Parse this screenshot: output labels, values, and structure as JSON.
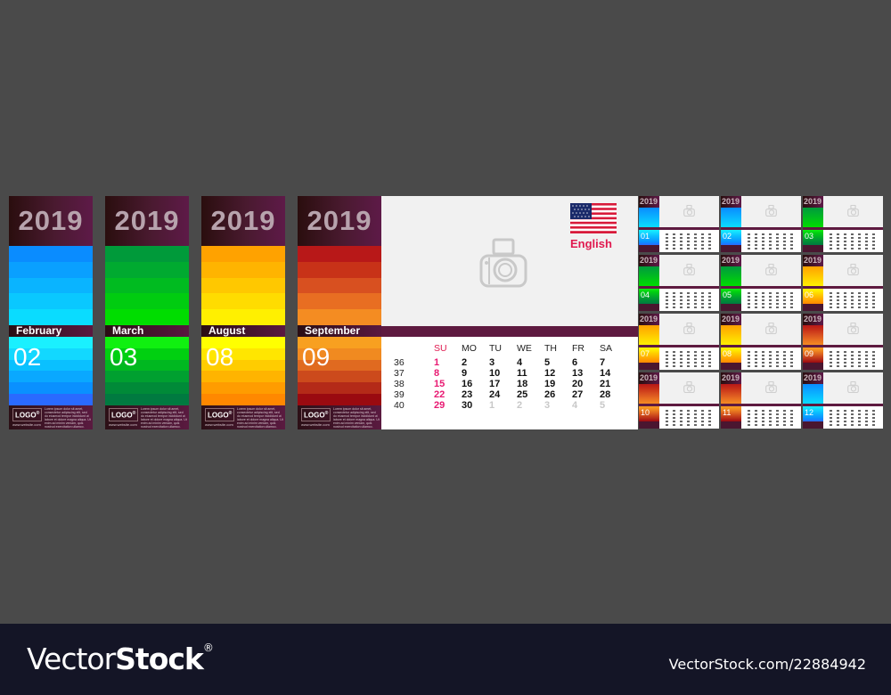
{
  "strips": [
    {
      "year": "2019",
      "month": "February",
      "number": "02",
      "theme": "blue"
    },
    {
      "year": "2019",
      "month": "March",
      "number": "03",
      "theme": "green"
    },
    {
      "year": "2019",
      "month": "August",
      "number": "08",
      "theme": "yellow"
    },
    {
      "year": "2019",
      "month": "September",
      "number": "09",
      "theme": "red"
    }
  ],
  "logo": {
    "text": "LOGO",
    "mark": "®",
    "website": "www.website.com",
    "lorem": "Lorem ipsum dolor sit amet, consectetur adipiscing elit, sed do eiusmod tempor incididunt ut labore et dolore magna aliqua. Ut enim ad minim veniam, quis nostrud exercitation ullamco."
  },
  "feature": {
    "language": "English",
    "flag_icon": "us-flag-icon",
    "photo_icon": "camera-icon",
    "weekdays": [
      "SU",
      "MO",
      "TU",
      "WE",
      "TH",
      "FR",
      "SA"
    ],
    "weeks": [
      {
        "wk": "36",
        "days": [
          "1",
          "2",
          "3",
          "4",
          "5",
          "6",
          "7"
        ],
        "muted": []
      },
      {
        "wk": "37",
        "days": [
          "8",
          "9",
          "10",
          "11",
          "12",
          "13",
          "14"
        ],
        "muted": []
      },
      {
        "wk": "38",
        "days": [
          "15",
          "16",
          "17",
          "18",
          "19",
          "20",
          "21"
        ],
        "muted": []
      },
      {
        "wk": "39",
        "days": [
          "22",
          "23",
          "24",
          "25",
          "26",
          "27",
          "28"
        ],
        "muted": []
      },
      {
        "wk": "40",
        "days": [
          "29",
          "30",
          "1",
          "2",
          "3",
          "4",
          "5"
        ],
        "muted": [
          2,
          3,
          4,
          5,
          6
        ]
      }
    ]
  },
  "minis": [
    {
      "year": "2019",
      "num": "01",
      "theme": "blue"
    },
    {
      "year": "2019",
      "num": "02",
      "theme": "blue"
    },
    {
      "year": "2019",
      "num": "03",
      "theme": "green"
    },
    {
      "year": "2019",
      "num": "04",
      "theme": "green"
    },
    {
      "year": "2019",
      "num": "05",
      "theme": "green"
    },
    {
      "year": "2019",
      "num": "06",
      "theme": "yellow"
    },
    {
      "year": "2019",
      "num": "07",
      "theme": "yellow"
    },
    {
      "year": "2019",
      "num": "08",
      "theme": "yellow"
    },
    {
      "year": "2019",
      "num": "09",
      "theme": "red"
    },
    {
      "year": "2019",
      "num": "10",
      "theme": "red"
    },
    {
      "year": "2019",
      "num": "11",
      "theme": "red"
    },
    {
      "year": "2019",
      "num": "12",
      "theme": "blue"
    }
  ],
  "themes": {
    "blue": {
      "top": [
        "#0a8cff",
        "#0aa0ff",
        "#0ab4ff",
        "#0ac8ff",
        "#0adcff"
      ],
      "bottom": [
        "#1af0ff",
        "#12d8ff",
        "#0ac0ff",
        "#0aa8ff",
        "#0a90ff",
        "#2a6aff"
      ]
    },
    "green": {
      "top": [
        "#009a3a",
        "#00aa30",
        "#00bb20",
        "#00cc10",
        "#00dd00"
      ],
      "bottom": [
        "#10f010",
        "#00d010",
        "#00b820",
        "#00a030",
        "#008a38",
        "#007a40"
      ]
    },
    "yellow": {
      "top": [
        "#ffa200",
        "#ffb400",
        "#ffc800",
        "#ffdc00",
        "#fff000"
      ],
      "bottom": [
        "#ffff00",
        "#ffe600",
        "#ffcc00",
        "#ffb400",
        "#ff9c00",
        "#ff8800"
      ]
    },
    "red": {
      "top": [
        "#b81818",
        "#c83218",
        "#d85020",
        "#e86e22",
        "#f48c22"
      ],
      "bottom": [
        "#f8a020",
        "#f08a20",
        "#e06a20",
        "#cc4a1c",
        "#b42a18",
        "#9a0a10"
      ]
    }
  },
  "footer": {
    "brand_light": "Vector",
    "brand_bold": "Stock",
    "brand_mark": "®",
    "url": "VectorStock.com/22884942"
  }
}
